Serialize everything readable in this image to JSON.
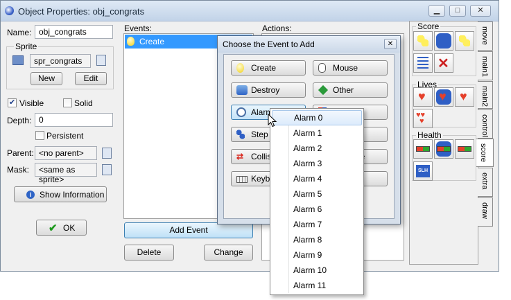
{
  "window": {
    "title": "Object Properties: obj_congrats",
    "minimize": "▁",
    "maximize": "□",
    "close": "✕"
  },
  "left": {
    "name_label": "Name:",
    "name_value": "obj_congrats",
    "sprite_group": "Sprite",
    "sprite_value": "spr_congrats",
    "new_btn": "New",
    "edit_btn": "Edit",
    "visible_label": "Visible",
    "visible_checked": true,
    "solid_label": "Solid",
    "solid_checked": false,
    "depth_label": "Depth:",
    "depth_value": "0",
    "persistent_label": "Persistent",
    "persistent_checked": false,
    "parent_label": "Parent:",
    "parent_value": "<no parent>",
    "mask_label": "Mask:",
    "mask_value": "<same as sprite>",
    "show_info_btn": "Show Information",
    "ok_btn": "OK"
  },
  "events": {
    "header": "Events:",
    "items": [
      {
        "label": "Create",
        "icon": "lightbulb-icon"
      }
    ],
    "add_btn": "Add Event",
    "delete_btn": "Delete",
    "change_btn": "Change"
  },
  "actions": {
    "header": "Actions:"
  },
  "palette": {
    "groups": [
      "Score",
      "Lives",
      "Health"
    ],
    "tabs": [
      "move",
      "main1",
      "main2",
      "control",
      "score",
      "extra",
      "draw"
    ],
    "active_tab": "score"
  },
  "dialog": {
    "title": "Choose the Event to Add",
    "close": "✕",
    "buttons": [
      {
        "label": "Create",
        "icon": "lightbulb-icon"
      },
      {
        "label": "Mouse",
        "icon": "mouse-icon"
      },
      {
        "label": "Destroy",
        "icon": "trash-icon"
      },
      {
        "label": "Other",
        "icon": "diamond-icon"
      },
      {
        "label": "Alarm",
        "icon": "clock-icon"
      },
      {
        "label": "Step",
        "icon": "step-icon"
      },
      {
        "label": "Collision",
        "icon": "collision-icon"
      },
      {
        "label": "Keyboard",
        "icon": "keyboard-icon"
      }
    ],
    "partial_labels": [
      "ase"
    ]
  },
  "alarm_menu": {
    "items": [
      "Alarm 0",
      "Alarm 1",
      "Alarm 2",
      "Alarm 3",
      "Alarm 4",
      "Alarm 5",
      "Alarm 6",
      "Alarm 7",
      "Alarm 8",
      "Alarm 9",
      "Alarm 10",
      "Alarm 11"
    ],
    "selected": "Alarm 0"
  }
}
